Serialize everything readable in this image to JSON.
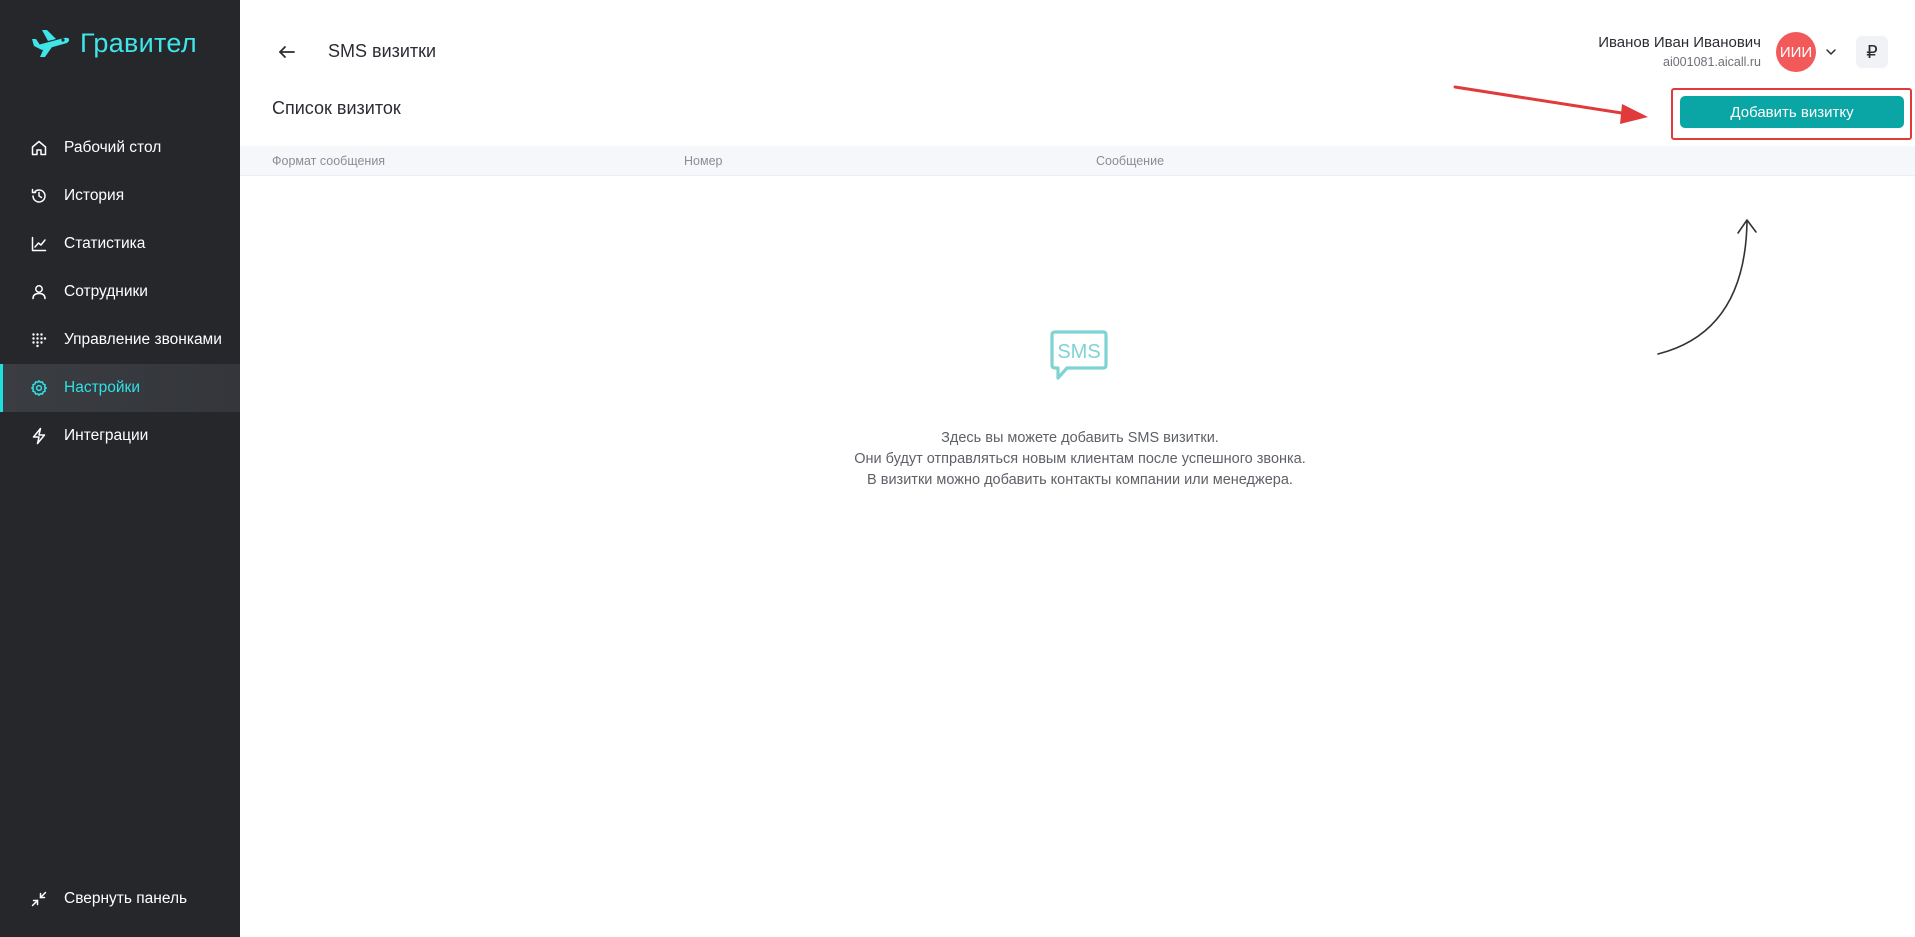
{
  "brand": {
    "name": "Гравител",
    "accent": "#3ee6ea",
    "logo_icon": "plane-icon"
  },
  "sidebar": {
    "items": [
      {
        "id": "dashboard",
        "label": "Рабочий стол",
        "icon": "home-icon",
        "active": false
      },
      {
        "id": "history",
        "label": "История",
        "icon": "history-icon",
        "active": false
      },
      {
        "id": "stats",
        "label": "Статистика",
        "icon": "chart-icon",
        "active": false
      },
      {
        "id": "employees",
        "label": "Сотрудники",
        "icon": "user-icon",
        "active": false
      },
      {
        "id": "calls",
        "label": "Управление звонками",
        "icon": "dialpad-icon",
        "active": false
      },
      {
        "id": "settings",
        "label": "Настройки",
        "icon": "gear-icon",
        "active": true
      },
      {
        "id": "integrations",
        "label": "Интеграции",
        "icon": "lightning-icon",
        "active": false
      }
    ],
    "collapse_label": "Свернуть панель"
  },
  "header": {
    "title": "SMS визитки",
    "user_name": "Иванов Иван Иванович",
    "user_domain": "ai001081.aicall.ru",
    "avatar_initials": "ИИИ",
    "currency_symbol": "₽"
  },
  "main": {
    "section_title": "Список визиток",
    "add_button_label": "Добавить визитку",
    "columns": [
      "Формат сообщения",
      "Номер",
      "Сообщение"
    ],
    "empty_icon_text": "SMS",
    "empty_lines": [
      "Здесь вы можете добавить SMS визитки.",
      "Они будут отправляться новым клиентам после успешного звонка.",
      "В визитки можно добавить контакты компании или менеджера."
    ]
  },
  "colors": {
    "sidebar_bg": "#26272b",
    "button": "#0aa5a5",
    "avatar": "#f25a5a",
    "annotation": "#e03a3a"
  }
}
